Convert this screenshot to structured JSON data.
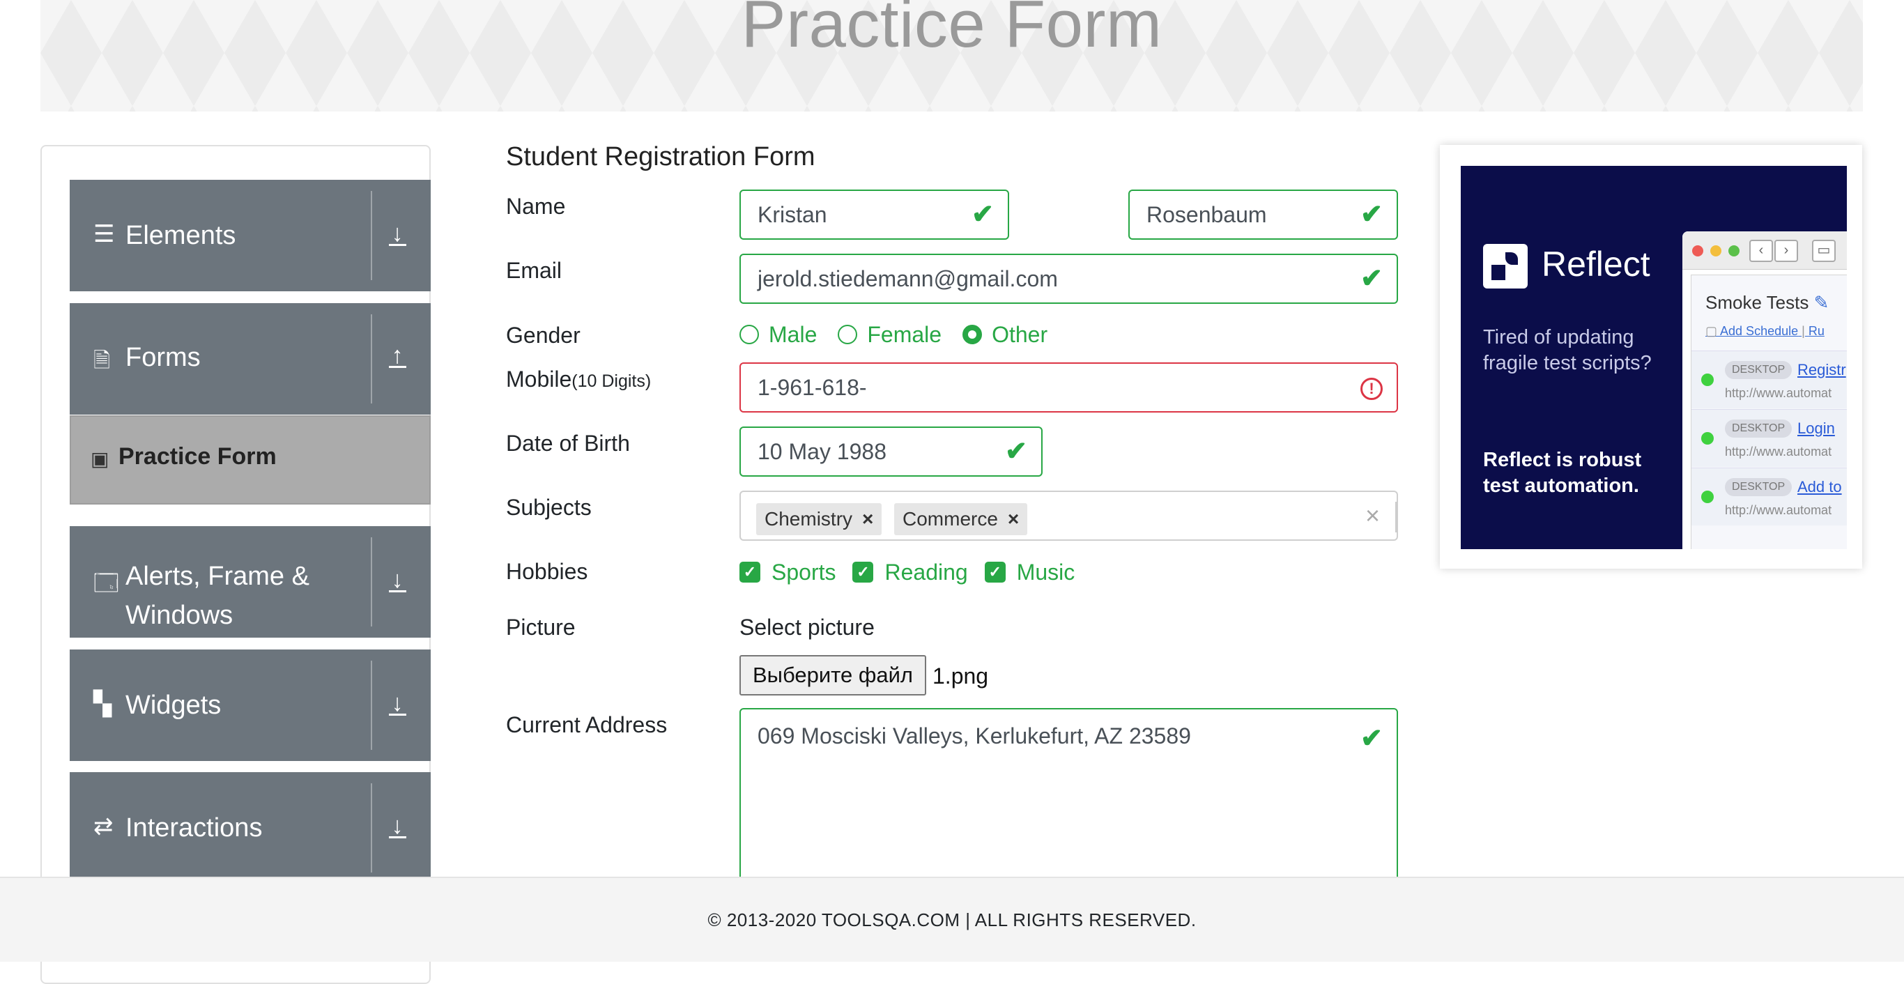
{
  "header": {
    "title": "Practice Form"
  },
  "sidebar": {
    "groups": [
      {
        "label": "Elements",
        "icon": "hamburger-icon",
        "arrow": "down"
      },
      {
        "label": "Forms",
        "icon": "document-icon",
        "arrow": "up"
      },
      {
        "label": "Alerts, Frame & Windows",
        "icon": "window-icon",
        "arrow": "down"
      },
      {
        "label": "Widgets",
        "icon": "widgets-icon",
        "arrow": "down"
      },
      {
        "label": "Interactions",
        "icon": "interactions-icon",
        "arrow": "down"
      }
    ],
    "active_item": {
      "label": "Practice Form",
      "icon": "html5-icon"
    }
  },
  "form": {
    "title": "Student Registration Form",
    "labels": {
      "name": "Name",
      "email": "Email",
      "gender": "Gender",
      "mobile": "Mobile",
      "mobile_hint": "(10 Digits)",
      "dob": "Date of Birth",
      "subjects": "Subjects",
      "hobbies": "Hobbies",
      "picture": "Picture",
      "address": "Current Address"
    },
    "first_name": "Kristan",
    "last_name": "Rosenbaum",
    "email": "jerold.stiedemann@gmail.com",
    "gender_options": [
      {
        "label": "Male",
        "selected": false
      },
      {
        "label": "Female",
        "selected": false
      },
      {
        "label": "Other",
        "selected": true
      }
    ],
    "mobile": "1-961-618-",
    "mobile_state": "invalid",
    "dob": "10 May 1988",
    "subjects": [
      "Chemistry",
      "Commerce"
    ],
    "hobbies": [
      {
        "label": "Sports",
        "checked": true
      },
      {
        "label": "Reading",
        "checked": true
      },
      {
        "label": "Music",
        "checked": true
      }
    ],
    "picture_prompt": "Select picture",
    "file_button": "Выберите файл",
    "file_name": "1.png",
    "address": "069 Mosciski Valleys, Kerlukefurt, AZ 23589"
  },
  "ad": {
    "brand": "Reflect",
    "line1": "Tired of updating fragile test scripts?",
    "line2": "Reflect is robust test automation.",
    "mock": {
      "title": "Smoke Tests",
      "add_schedule": "Add Schedule",
      "run": "Ru",
      "rows": [
        {
          "tag": "DESKTOP",
          "link": "Registr",
          "url": "http://www.automat"
        },
        {
          "tag": "DESKTOP",
          "link": "Login",
          "url": "http://www.automat"
        },
        {
          "tag": "DESKTOP",
          "link": "Add to",
          "url": "http://www.automat"
        }
      ]
    }
  },
  "footer": {
    "text": "© 2013-2020 TOOLSQA.COM | ALL RIGHTS RESERVED."
  },
  "colors": {
    "valid": "#28a745",
    "invalid": "#dc3545",
    "sidebar": "#6c757d",
    "ad_bg": "#0b0d4a"
  }
}
